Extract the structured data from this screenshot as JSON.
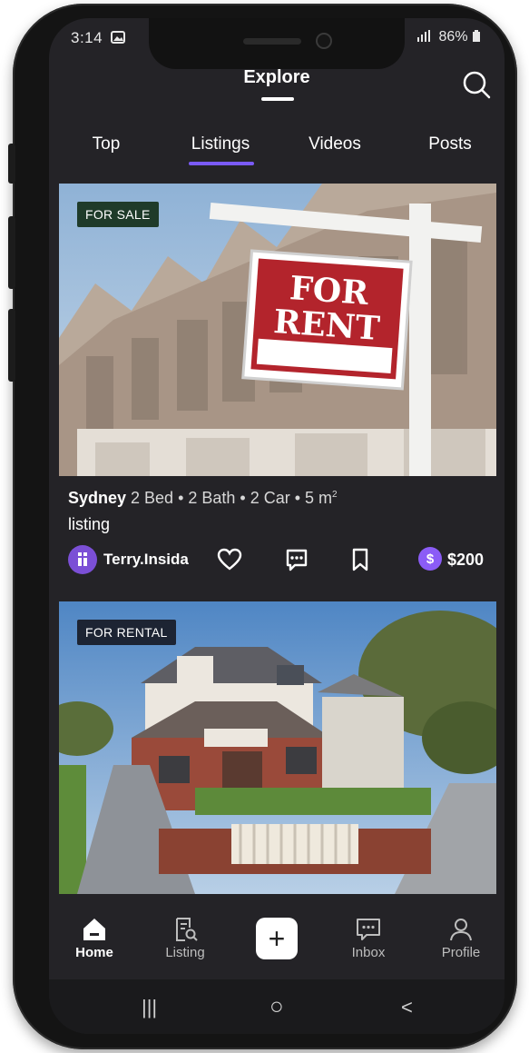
{
  "status_bar": {
    "time": "3:14",
    "right": "86%"
  },
  "header": {
    "title": "Explore"
  },
  "tabs": [
    {
      "label": "Top"
    },
    {
      "label": "Listings"
    },
    {
      "label": "Videos"
    },
    {
      "label": "Posts"
    }
  ],
  "active_tab": "Listings",
  "listings": [
    {
      "badge": "FOR SALE",
      "sign_line1": "FOR",
      "sign_line2": "RENT",
      "city": "Sydney",
      "details": " 2 Bed • 2 Bath • 2 Car • 5 m",
      "details_sup": "2",
      "type": "listing",
      "user": "Terry.Insida",
      "price": "$200",
      "coin_symbol": "$"
    },
    {
      "badge": "FOR RENTAL"
    }
  ],
  "bottom_nav": [
    {
      "label": "Home",
      "icon": "home-icon"
    },
    {
      "label": "Listing",
      "icon": "listing-icon"
    },
    {
      "label": "Inbox",
      "icon": "inbox-icon"
    },
    {
      "label": "Profile",
      "icon": "profile-icon"
    }
  ],
  "add_button_symbol": "+",
  "system_nav": {
    "recents": "|||",
    "home": "○",
    "back": "<"
  },
  "colors": {
    "background": "#242327",
    "accent": "#7a5af8",
    "coin": "#8b5cf6",
    "badge_sale": "#1f3b2a",
    "badge_rental": "#1d2433"
  }
}
